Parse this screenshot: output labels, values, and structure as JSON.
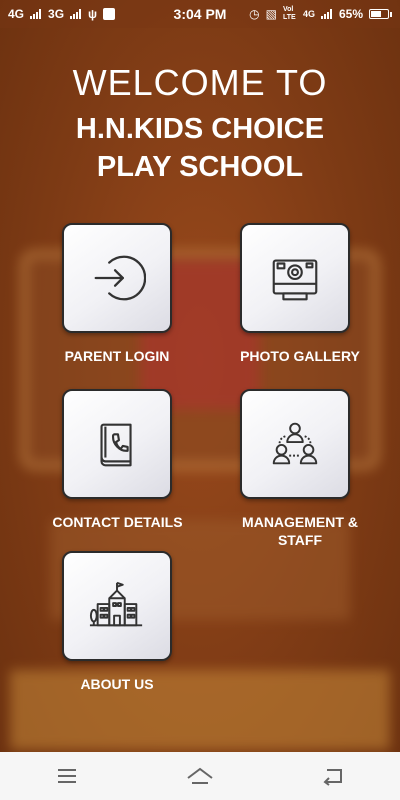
{
  "status_bar": {
    "network_1": "4G",
    "network_2": "3G",
    "time": "3:04 PM",
    "volte": "Vol LTE",
    "network_3": "4G",
    "battery_percent": "65%",
    "battery_level": 0.65
  },
  "header": {
    "welcome": "WELCOME TO",
    "school_line1": "H.N.KIDS CHOICE",
    "school_line2": "PLAY SCHOOL"
  },
  "menu": [
    {
      "label": "PARENT LOGIN",
      "icon": "login-icon"
    },
    {
      "label": "PHOTO GALLERY",
      "icon": "camera-icon"
    },
    {
      "label": "CONTACT DETAILS",
      "icon": "phone-book-icon"
    },
    {
      "label_line1": "MANAGEMENT &",
      "label_line2": "STAFF",
      "icon": "team-icon"
    },
    {
      "label": "ABOUT US",
      "icon": "school-building-icon"
    }
  ],
  "nav_bar": {
    "menu": "menu-icon",
    "home": "home-icon",
    "back": "back-icon"
  },
  "colors": {
    "background": "#7a3a14",
    "tile": "#ffffff",
    "text": "#ffffff"
  }
}
